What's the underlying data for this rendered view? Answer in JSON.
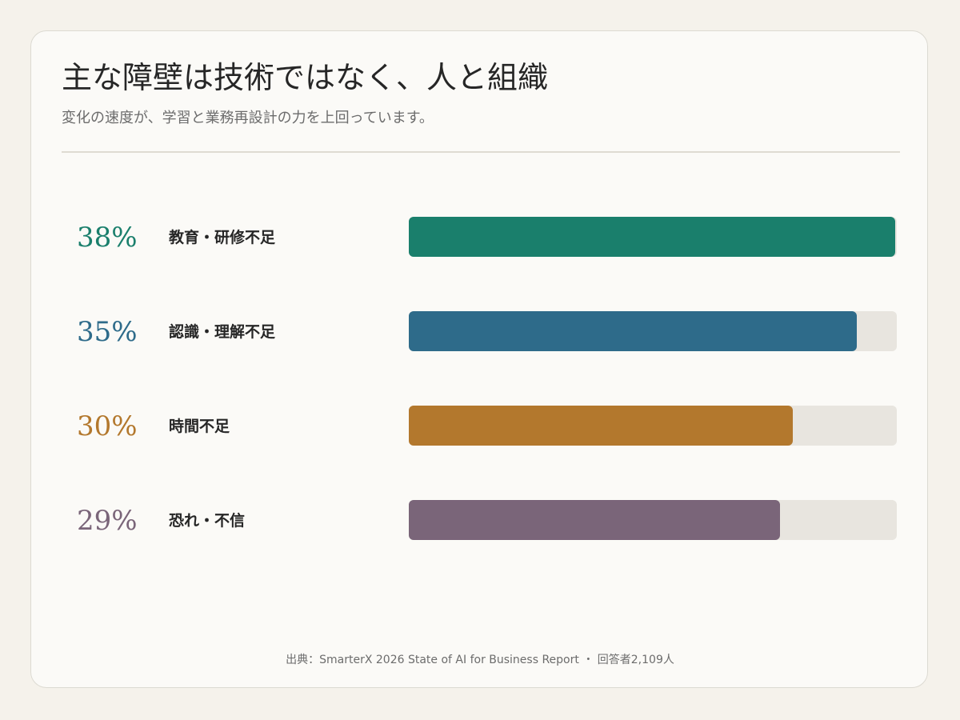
{
  "title": "主な障壁は技術ではなく、人と組織",
  "subtitle": "変化の速度が、学習と業務再設計の力を上回っています。",
  "source": "出典：SmarterX 2026 State of AI for Business Report ・ 回答者2,109人",
  "colors": {
    "track": "#e8e5df",
    "series": [
      "#1a7f6c",
      "#2e6b8a",
      "#b3782d",
      "#7a6579"
    ]
  },
  "chart_data": {
    "type": "bar",
    "orientation": "horizontal",
    "categories": [
      "教育・研修不足",
      "認識・理解不足",
      "時間不足",
      "恐れ・不信"
    ],
    "values": [
      38,
      35,
      30,
      29
    ],
    "value_labels": [
      "38%",
      "35%",
      "30%",
      "29%"
    ],
    "xlim": [
      0,
      38
    ],
    "title": "主な障壁は技術ではなく、人と組織",
    "grid": false,
    "legend": "none"
  }
}
